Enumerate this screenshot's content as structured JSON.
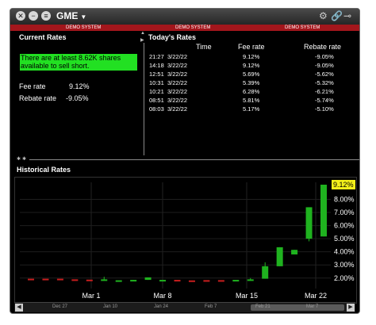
{
  "titlebar": {
    "symbol": "GME"
  },
  "demo_labels": [
    "DEMO SYSTEM",
    "DEMO SYSTEM",
    "DEMO SYSTEM"
  ],
  "current_rates": {
    "title": "Current Rates",
    "availability": "There are at least 8.62K shares available to sell short.",
    "fee_label": "Fee rate",
    "fee_value": "9.12%",
    "rebate_label": "Rebate rate",
    "rebate_value": "-9.05%"
  },
  "todays_rates": {
    "title": "Today's Rates",
    "headers": {
      "time": "Time",
      "fee": "Fee rate",
      "rebate": "Rebate rate"
    },
    "rows": [
      {
        "time": "21:27",
        "date": "3/22/22",
        "fee": "9.12%",
        "rebate": "-9.05%"
      },
      {
        "time": "14:18",
        "date": "3/22/22",
        "fee": "9.12%",
        "rebate": "-9.05%"
      },
      {
        "time": "12:51",
        "date": "3/22/22",
        "fee": "5.69%",
        "rebate": "-5.62%"
      },
      {
        "time": "10:31",
        "date": "3/22/22",
        "fee": "5.39%",
        "rebate": "-5.32%"
      },
      {
        "time": "10:21",
        "date": "3/22/22",
        "fee": "6.28%",
        "rebate": "-6.21%"
      },
      {
        "time": "08:51",
        "date": "3/22/22",
        "fee": "5.81%",
        "rebate": "-5.74%"
      },
      {
        "time": "08:03",
        "date": "3/22/22",
        "fee": "5.17%",
        "rebate": "-5.10%"
      }
    ]
  },
  "historical": {
    "title": "Historical Rates"
  },
  "chart_data": {
    "type": "candlestick",
    "x_tick_labels": [
      "Mar 1",
      "Mar 8",
      "Mar 15",
      "Mar 22"
    ],
    "y_tick_labels": [
      "2.00%",
      "3.00%",
      "4.00%",
      "5.00%",
      "6.00%",
      "7.00%",
      "8.00%"
    ],
    "ylim": [
      1.2,
      9.3
    ],
    "current_value_label": "9.12%",
    "candles": [
      {
        "open": 1.95,
        "close": 1.95,
        "high": 1.95,
        "low": 1.95,
        "color": "#c81e1e"
      },
      {
        "open": 1.95,
        "close": 1.95,
        "high": 1.95,
        "low": 1.95,
        "color": "#c81e1e"
      },
      {
        "open": 1.95,
        "close": 1.95,
        "high": 1.95,
        "low": 1.95,
        "color": "#c81e1e"
      },
      {
        "open": 1.9,
        "close": 1.9,
        "high": 1.9,
        "low": 1.9,
        "color": "#c81e1e"
      },
      {
        "open": 1.88,
        "close": 1.88,
        "high": 1.88,
        "low": 1.88,
        "color": "#c81e1e"
      },
      {
        "open": 1.86,
        "close": 1.9,
        "high": 2.1,
        "low": 1.86,
        "color": "#1fb21f"
      },
      {
        "open": 1.83,
        "close": 1.83,
        "high": 1.83,
        "low": 1.83,
        "color": "#1fb21f"
      },
      {
        "open": 1.83,
        "close": 1.86,
        "high": 1.86,
        "low": 1.83,
        "color": "#1fb21f"
      },
      {
        "open": 1.86,
        "close": 2.05,
        "high": 2.05,
        "low": 1.86,
        "color": "#1fb21f"
      },
      {
        "open": 1.86,
        "close": 1.86,
        "high": 1.86,
        "low": 1.86,
        "color": "#1fb21f"
      },
      {
        "open": 1.86,
        "close": 1.86,
        "high": 1.86,
        "low": 1.86,
        "color": "#c81e1e"
      },
      {
        "open": 1.82,
        "close": 1.82,
        "high": 1.82,
        "low": 1.82,
        "color": "#c81e1e"
      },
      {
        "open": 1.84,
        "close": 1.84,
        "high": 1.84,
        "low": 1.84,
        "color": "#c81e1e"
      },
      {
        "open": 1.84,
        "close": 1.84,
        "high": 1.84,
        "low": 1.84,
        "color": "#c81e1e"
      },
      {
        "open": 1.86,
        "close": 1.86,
        "high": 1.86,
        "low": 1.86,
        "color": "#1fb21f"
      },
      {
        "open": 1.86,
        "close": 1.9,
        "high": 2.0,
        "low": 1.86,
        "color": "#1fb21f"
      },
      {
        "open": 1.95,
        "close": 2.9,
        "high": 3.2,
        "low": 1.95,
        "color": "#1fb21f"
      },
      {
        "open": 2.9,
        "close": 4.35,
        "high": 4.35,
        "low": 2.9,
        "color": "#1fb21f"
      },
      {
        "open": 3.8,
        "close": 4.15,
        "high": 4.15,
        "low": 3.8,
        "color": "#1fb21f"
      },
      {
        "open": 5.0,
        "close": 7.4,
        "high": 7.4,
        "low": 4.8,
        "color": "#1fb21f"
      },
      {
        "open": 5.17,
        "close": 9.12,
        "high": 9.12,
        "low": 5.17,
        "color": "#1fb21f"
      }
    ]
  },
  "scrollbar": {
    "labels": [
      "Dec 27",
      "Jan 10",
      "Jan 24",
      "Feb 7",
      "Feb 21",
      "Mar 7"
    ]
  },
  "colors": {
    "accent_green": "#22e022",
    "candle_up": "#1fb21f",
    "candle_down": "#c81e1e",
    "current_price_highlight": "#f3ef1a",
    "demo_bar": "#a3161c"
  }
}
